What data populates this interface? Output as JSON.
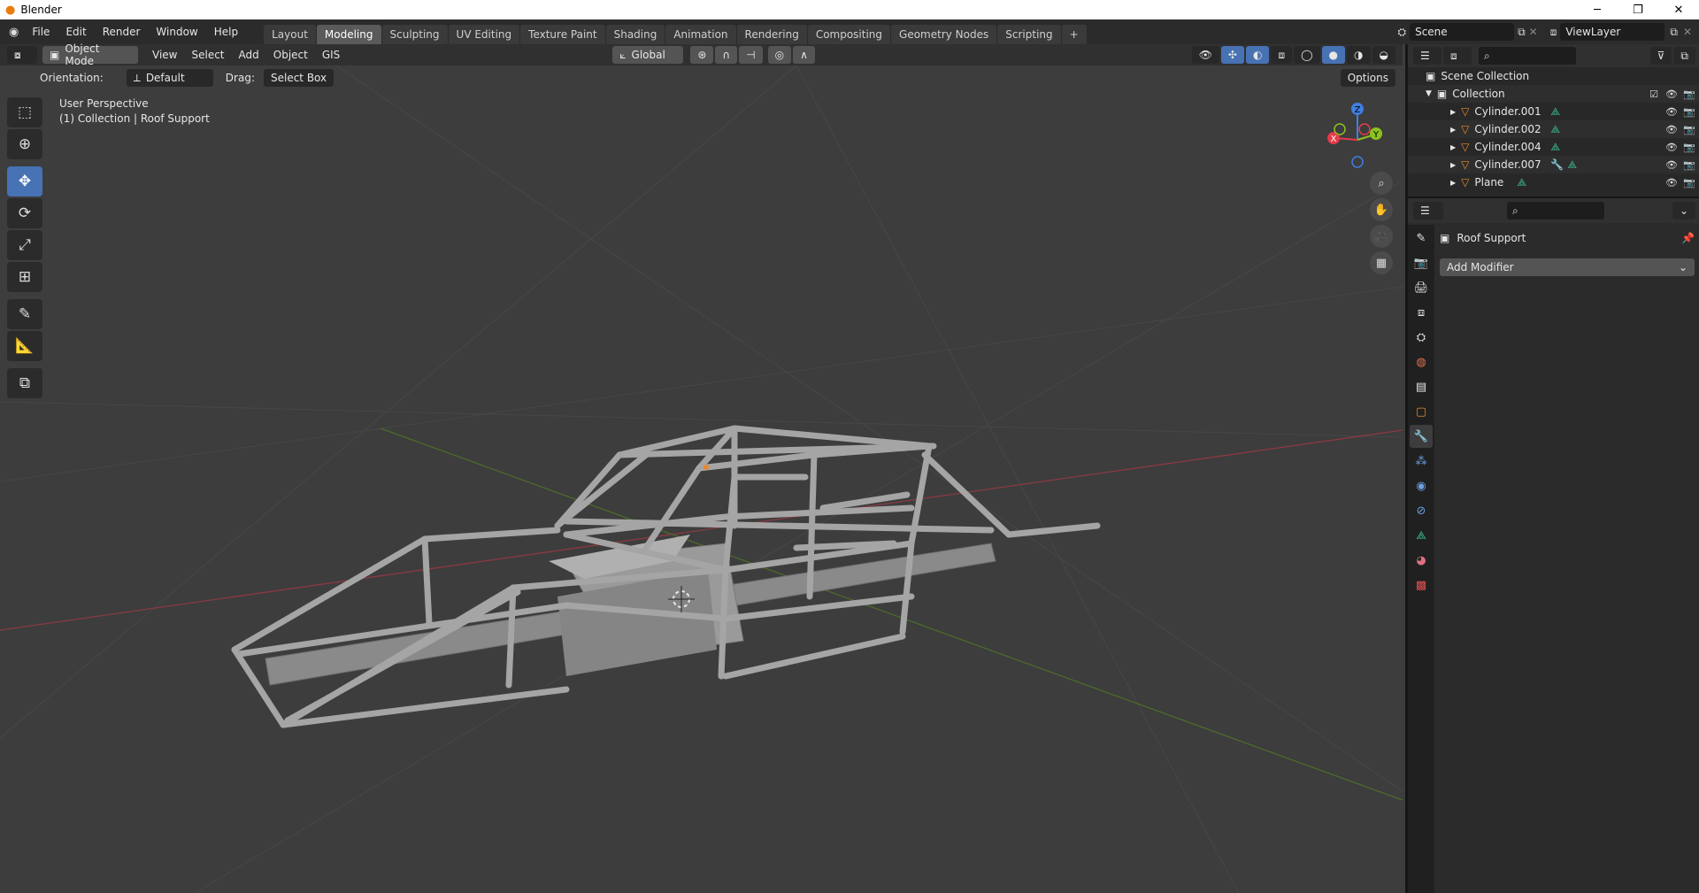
{
  "window": {
    "title": "Blender",
    "minimize": "─",
    "maximize": "❐",
    "close": "✕"
  },
  "menus": [
    "File",
    "Edit",
    "Render",
    "Window",
    "Help"
  ],
  "workspaces": [
    "Layout",
    "Modeling",
    "Sculpting",
    "UV Editing",
    "Texture Paint",
    "Shading",
    "Animation",
    "Rendering",
    "Compositing",
    "Geometry Nodes",
    "Scripting"
  ],
  "active_workspace": "Modeling",
  "add_workspace": "+",
  "scene": {
    "name": "Scene",
    "view_layer": "ViewLayer"
  },
  "header": {
    "mode": "Object Mode",
    "menus": [
      "View",
      "Select",
      "Add",
      "Object",
      "GIS"
    ],
    "transform_orientation": "Global"
  },
  "tool_settings": {
    "orientation_label": "Orientation:",
    "orientation_value": "Default",
    "drag_label": "Drag:",
    "drag_value": "Select Box",
    "options": "Options"
  },
  "viewport": {
    "perspective": "User Perspective",
    "context": "(1) Collection | Roof Support",
    "gizmo": {
      "z": "Z",
      "y": "Y",
      "x": "X"
    }
  },
  "outliner": {
    "root": "Scene Collection",
    "collection": "Collection",
    "objects": [
      "Cylinder.001",
      "Cylinder.002",
      "Cylinder.004",
      "Cylinder.007",
      "Plane"
    ]
  },
  "properties": {
    "object_name": "Roof Support",
    "add_modifier": "Add Modifier"
  },
  "colors": {
    "accent": "#4772b3",
    "axis_x": "#e53a4a",
    "axis_y": "#8bc220",
    "axis_z": "#3f7fe0",
    "mesh": "#9a9a9a",
    "object_orange": "#e6892c",
    "mesh_data_green": "#3cc098"
  }
}
